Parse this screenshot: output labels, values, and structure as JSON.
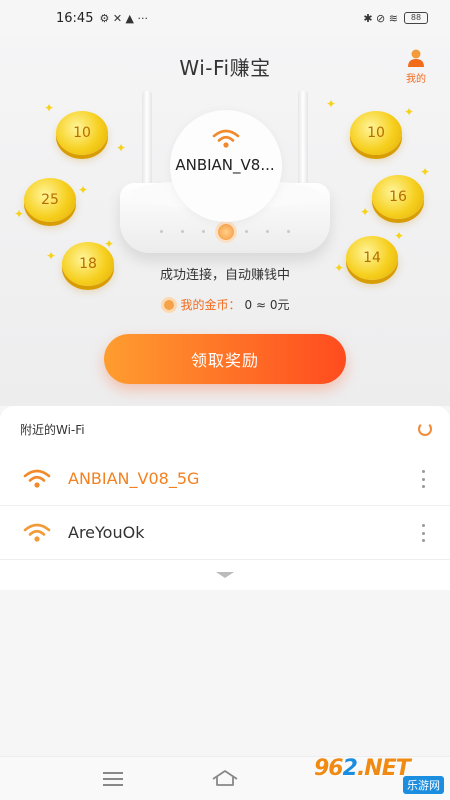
{
  "status_bar": {
    "time": "16:45",
    "left_icons": "⚙ ✕ ▲ ···",
    "right_icons": "✱ ⊘ ≋",
    "battery": "88"
  },
  "header": {
    "title": "Wi-Fi赚宝",
    "profile_label": "我的"
  },
  "hero": {
    "current_network": "ANBIAN_V8...",
    "status_text": "成功连接，自动赚钱中",
    "coins_label": "我的金币：",
    "coins_value": "0 ≈ 0元",
    "coins": [
      "10",
      "25",
      "18",
      "10",
      "16",
      "14"
    ],
    "claim_button": "领取奖励"
  },
  "nearby": {
    "title": "附近的Wi-Fi",
    "networks": [
      {
        "name": "ANBIAN_V08_5G",
        "connected": true
      },
      {
        "name": "AreYouOk",
        "connected": false
      }
    ]
  },
  "watermark": {
    "brand_a": "96",
    "brand_b": "2",
    "brand_c": ".NET",
    "sub": "乐游网"
  },
  "colors": {
    "accent": "#f26b1d",
    "button_start": "#ff9d2f",
    "button_end": "#ff4b1f",
    "coin": "#f6cf1e"
  }
}
